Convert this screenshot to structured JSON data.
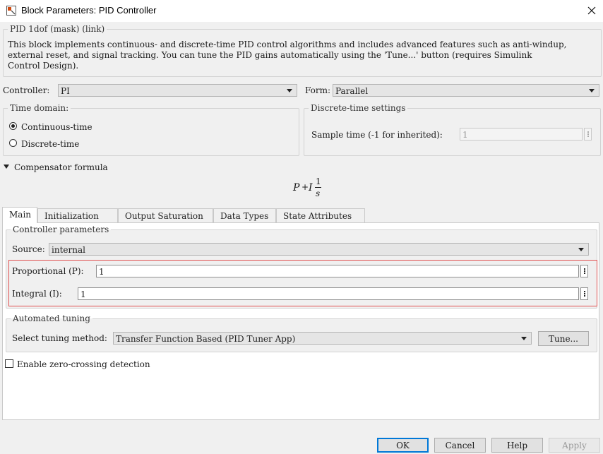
{
  "window": {
    "title": "Block Parameters: PID Controller"
  },
  "mask": {
    "legend": "PID 1dof (mask) (link)",
    "description": [
      "This block implements continuous- and discrete-time PID control algorithms and includes advanced features such as anti-windup,",
      "external reset, and signal tracking. You can tune the PID gains automatically using the 'Tune...' button (requires Simulink",
      "Control Design)."
    ]
  },
  "controller": {
    "label": "Controller:",
    "value": "PI"
  },
  "form": {
    "label": "Form:",
    "value": "Parallel"
  },
  "time_domain": {
    "legend": "Time domain:",
    "options": [
      {
        "label": "Continuous-time",
        "selected": true
      },
      {
        "label": "Discrete-time",
        "selected": false
      }
    ]
  },
  "discrete_settings": {
    "legend": "Discrete-time settings",
    "sample_time_label": "Sample time (-1 for inherited):",
    "sample_time_value": "1"
  },
  "compensator": {
    "label": "Compensator formula",
    "formula_P": "P",
    "formula_plus": "+",
    "formula_I": "I",
    "formula_num": "1",
    "formula_den": "s"
  },
  "tabs": [
    "Main",
    "Initialization",
    "Output Saturation",
    "Data Types",
    "State Attributes"
  ],
  "active_tab": "Main",
  "controller_parameters": {
    "legend": "Controller parameters",
    "source_label": "Source:",
    "source_value": "internal",
    "proportional_label": "Proportional (P):",
    "proportional_value": "1",
    "integral_label": "Integral (I):",
    "integral_value": "1",
    "highlight_color": "#e05050"
  },
  "automated_tuning": {
    "legend": "Automated tuning",
    "method_label": "Select tuning method:",
    "method_value": "Transfer Function Based (PID Tuner App)",
    "tune_button": "Tune..."
  },
  "zero_crossing": {
    "label": "Enable zero-crossing detection",
    "checked": false
  },
  "buttons": {
    "ok": "OK",
    "cancel": "Cancel",
    "help": "Help",
    "apply": "Apply"
  }
}
